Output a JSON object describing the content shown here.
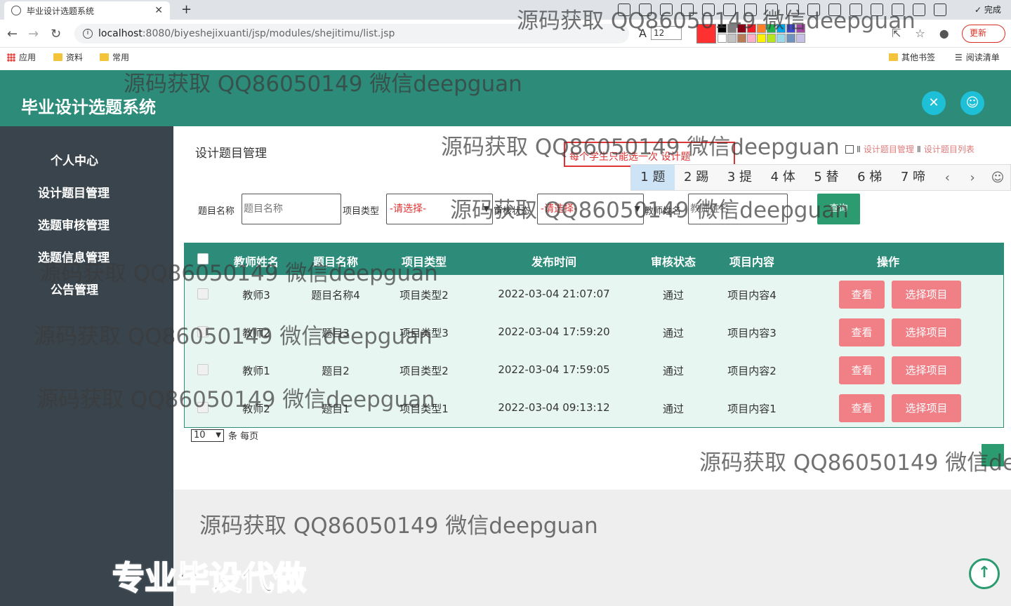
{
  "browser": {
    "tab_title": "毕业设计选题系统",
    "new_tab": "+",
    "close": "✕",
    "url_host": "localhost",
    "url_path": ":8080/biyeshejixuanti/jsp/modules/shejitimu/list.jsp",
    "font_size_value": "12",
    "finish_label": "✓ 完成",
    "update_label": "更新",
    "bookmarks": {
      "apps": "应用",
      "ziliao": "资料",
      "changyong": "常用",
      "other": "其他书签",
      "reading": "阅读清单"
    }
  },
  "header": {
    "title": "毕业设计选题系统"
  },
  "sidebar": {
    "items": [
      {
        "label": "个人中心"
      },
      {
        "label": "设计题目管理"
      },
      {
        "label": "选题审核管理"
      },
      {
        "label": "选题信息管理"
      },
      {
        "label": "公告管理"
      }
    ]
  },
  "page": {
    "title": "设计题目管理",
    "breadcrumb": [
      "设计题目管理",
      "设计题目列表"
    ],
    "breadcrumb_sep": "Ⅱ"
  },
  "ime": {
    "composition": "每个学生只能选一次 设计题",
    "candidates": [
      "1 题",
      "2 踢",
      "3 提",
      "4 体",
      "5 替",
      "6 梯",
      "7 啼"
    ]
  },
  "search": {
    "title_label": "题目名称",
    "title_placeholder": "题目名称",
    "type_label": "项目类型",
    "type_value": "-请选择-",
    "status_label": "审核状态",
    "status_value": "-请选择-",
    "teacher_label": "教师姓名",
    "teacher_placeholder": "教师姓名",
    "query_label": "查询"
  },
  "table": {
    "headers": [
      "教师姓名",
      "题目名称",
      "项目类型",
      "发布时间",
      "审核状态",
      "项目内容",
      "操作"
    ],
    "rows": [
      [
        "教师3",
        "题目名称4",
        "项目类型2",
        "2022-03-04 21:07:07",
        "通过",
        "项目内容4"
      ],
      [
        "教师2",
        "题目3",
        "项目类型3",
        "2022-03-04 17:59:20",
        "通过",
        "项目内容3"
      ],
      [
        "教师1",
        "题目2",
        "项目类型2",
        "2022-03-04 17:59:05",
        "通过",
        "项目内容2"
      ],
      [
        "教师2",
        "题目1",
        "项目类型1",
        "2022-03-04 09:13:12",
        "通过",
        "项目内容1"
      ]
    ],
    "view_label": "查看",
    "select_label": "选择项目"
  },
  "pager": {
    "page_size": "10",
    "suffix": "条 每页"
  },
  "overlay": {
    "watermark": "源码获取 QQ86050149 微信deepguan",
    "watermark_cut": "源码获取 QQ86050149 微信dee",
    "promo": "专业毕设代做"
  },
  "colors": {
    "header": "#2c8c79",
    "sidebar": "#39444c",
    "action_button": "#f07f86",
    "query_button": "#2c9b6f"
  }
}
